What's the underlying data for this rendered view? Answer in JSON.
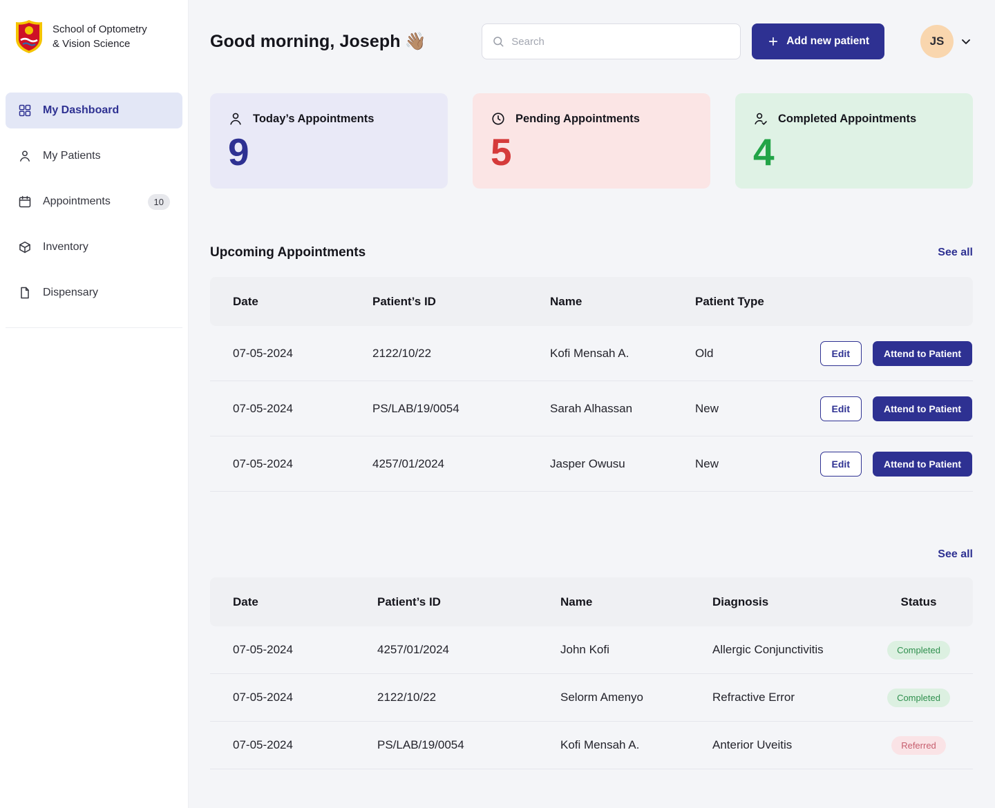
{
  "colors": {
    "primary": "#2E3192",
    "page_bg": "#F4F5F8",
    "card_lavender": "#E9E9F7",
    "card_pink": "#FBE5E5",
    "card_green": "#DFF2E5",
    "stat_indigo": "#2E3192",
    "stat_red": "#D53B3B",
    "stat_green": "#22A447"
  },
  "sidebar": {
    "org_line1": "School of Optometry",
    "org_line2": "& Vision Science",
    "items": [
      {
        "label": "My Dashboard"
      },
      {
        "label": "My Patients"
      },
      {
        "label": "Appointments",
        "badge": "10"
      },
      {
        "label": "Inventory"
      },
      {
        "label": "Dispensary"
      }
    ]
  },
  "header": {
    "greeting": "Good morning, Joseph",
    "greeting_emoji": "👋🏽",
    "search_placeholder": "Search",
    "add_patient_label": "Add new patient",
    "avatar_initials": "JS"
  },
  "stats": [
    {
      "label": "Today’s Appointments",
      "value": "9"
    },
    {
      "label": "Pending Appointments",
      "value": "5"
    },
    {
      "label": "Completed Appointments",
      "value": "4"
    }
  ],
  "upcoming": {
    "title": "Upcoming Appointments",
    "see_all": "See all",
    "columns": {
      "date": "Date",
      "id": "Patient’s ID",
      "name": "Name",
      "type": "Patient Type"
    },
    "edit_label": "Edit",
    "attend_label": "Attend to Patient",
    "rows": [
      {
        "date": "07-05-2024",
        "id": "2122/10/22",
        "name": "Kofi Mensah A.",
        "type": "Old"
      },
      {
        "date": "07-05-2024",
        "id": "PS/LAB/19/0054",
        "name": "Sarah Alhassan",
        "type": "New"
      },
      {
        "date": "07-05-2024",
        "id": "4257/01/2024",
        "name": "Jasper Owusu",
        "type": "New"
      }
    ]
  },
  "recent": {
    "see_all": "See all",
    "columns": {
      "date": "Date",
      "id": "Patient’s ID",
      "name": "Name",
      "diagnosis": "Diagnosis",
      "status": "Status"
    },
    "rows": [
      {
        "date": "07-05-2024",
        "id": "4257/01/2024",
        "name": "John Kofi",
        "diagnosis": "Allergic Conjunctivitis",
        "status": "Completed"
      },
      {
        "date": "07-05-2024",
        "id": "2122/10/22",
        "name": "Selorm Amenyo",
        "diagnosis": "Refractive Error",
        "status": "Completed"
      },
      {
        "date": "07-05-2024",
        "id": "PS/LAB/19/0054",
        "name": "Kofi Mensah A.",
        "diagnosis": "Anterior Uveitis",
        "status": "Referred"
      }
    ]
  }
}
